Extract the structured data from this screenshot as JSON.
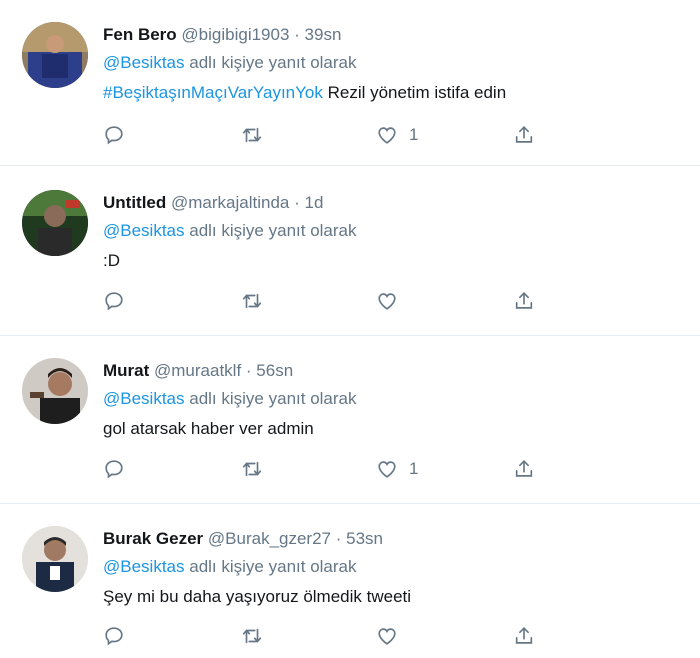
{
  "tweets": [
    {
      "name": "Fen Bero",
      "handle": "@bigibigi1903",
      "time": "· 39sn",
      "mention": "@Besiktas",
      "reply_text": "adlı kişiye yanıt olarak",
      "hashtag": "#BeşiktaşınMaçıVarYayınYok",
      "text": " Rezil yönetim istifa edin",
      "like_count": "1"
    },
    {
      "name": "Untitled",
      "handle": "@markajaltinda",
      "time": "· 1d",
      "mention": "@Besiktas",
      "reply_text": "adlı kişiye yanıt olarak",
      "text": ":D",
      "like_count": ""
    },
    {
      "name": "Murat",
      "handle": "@muraatklf",
      "time": "· 56sn",
      "mention": "@Besiktas",
      "reply_text": "adlı kişiye yanıt olarak",
      "text": "gol atarsak haber ver admin",
      "like_count": "1"
    },
    {
      "name": "Burak Gezer",
      "handle": "@Burak_gzer27",
      "time": "· 53sn",
      "mention": "@Besiktas",
      "reply_text": "adlı kişiye yanıt olarak",
      "text": "Şey mi bu daha yaşıyoruz ölmedik tweeti",
      "like_count": ""
    }
  ],
  "colors": {
    "link": "#1b95e0",
    "secondary": "#657786",
    "divider": "#e6ecf0"
  },
  "icons": [
    "reply-icon",
    "retweet-icon",
    "like-icon",
    "share-icon"
  ]
}
